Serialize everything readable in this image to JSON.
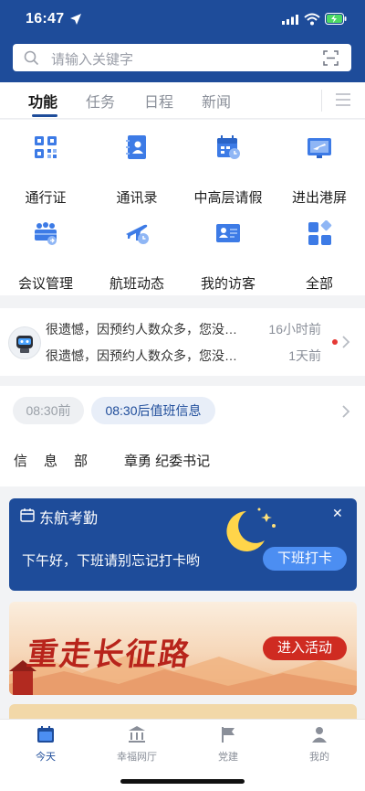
{
  "status_bar": {
    "time": "16:47"
  },
  "search": {
    "placeholder": "请输入关键字"
  },
  "tabs": [
    {
      "label": "功能",
      "active": true
    },
    {
      "label": "任务",
      "active": false
    },
    {
      "label": "日程",
      "active": false
    },
    {
      "label": "新闻",
      "active": false
    }
  ],
  "functions": [
    {
      "label": "通行证",
      "icon": "qr-code-icon"
    },
    {
      "label": "通讯录",
      "icon": "contacts-book-icon"
    },
    {
      "label": "中高层请假",
      "icon": "calendar-leave-icon"
    },
    {
      "label": "进出港屏",
      "icon": "flight-board-icon"
    },
    {
      "label": "会议管理",
      "icon": "meeting-icon"
    },
    {
      "label": "航班动态",
      "icon": "plane-clock-icon"
    },
    {
      "label": "我的访客",
      "icon": "visitor-card-icon"
    },
    {
      "label": "全部",
      "icon": "all-apps-icon"
    }
  ],
  "messages": [
    {
      "text": "很遗憾，因预约人数众多，您没有…",
      "time": "16小时前"
    },
    {
      "text": "很遗憾，因预约人数众多，您没有预约…",
      "time": "1天前"
    }
  ],
  "duty": {
    "earlier_chip": "08:30前",
    "later_chip": "08:30后值班信息",
    "department": "信息部",
    "person": "章勇 纪委书记"
  },
  "attendance": {
    "title": "东航考勤",
    "message": "下午好，下班请别忘记打卡哟",
    "button": "下班打卡",
    "close": "✕"
  },
  "banner": {
    "title": "重走长征路",
    "button": "进入活动"
  },
  "bottom_nav": [
    {
      "label": "今天",
      "active": true
    },
    {
      "label": "幸福网厅",
      "active": false
    },
    {
      "label": "党建",
      "active": false
    },
    {
      "label": "我的",
      "active": false
    }
  ],
  "colors": {
    "brand": "#1e4c9a",
    "accent_blue": "#4c8ef2",
    "banner_red": "#cf2b21",
    "unread_dot": "#e53935"
  }
}
